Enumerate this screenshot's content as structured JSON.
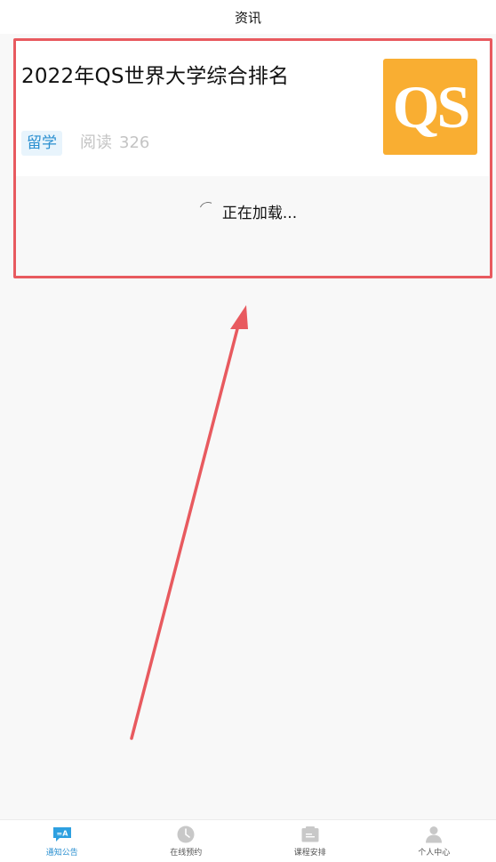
{
  "header": {
    "title": "资讯"
  },
  "article": {
    "title": "2022年QS世界大学综合排名",
    "tag": "留学",
    "read_label": "阅读",
    "read_count": "326",
    "thumbnail_text": "QS",
    "thumbnail_color": "#f9ae32"
  },
  "loading": {
    "text": "正在加载..."
  },
  "annotation": {
    "color": "#e85a5f"
  },
  "tabbar": {
    "items": [
      {
        "label": "通知公告",
        "icon": "notice-icon",
        "active": true
      },
      {
        "label": "在线预约",
        "icon": "clock-icon",
        "active": false
      },
      {
        "label": "课程安排",
        "icon": "schedule-icon",
        "active": false
      },
      {
        "label": "个人中心",
        "icon": "person-icon",
        "active": false
      }
    ]
  },
  "colors": {
    "accent": "#2a8fd0",
    "background": "#f8f8f8",
    "inactive_icon": "#c8c8c8"
  }
}
